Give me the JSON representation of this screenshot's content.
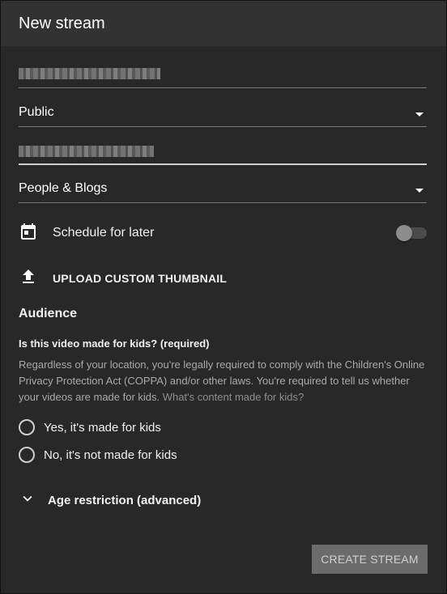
{
  "header": {
    "title": "New stream"
  },
  "visibility": {
    "value": "Public"
  },
  "category": {
    "value": "People & Blogs"
  },
  "schedule": {
    "label": "Schedule for later",
    "enabled": false
  },
  "thumbnail": {
    "label": "UPLOAD CUSTOM THUMBNAIL"
  },
  "audience": {
    "title": "Audience",
    "question": "Is this video made for kids? (required)",
    "description": "Regardless of your location, you're legally required to comply with the Children's Online Privacy Protection Act (COPPA) and/or other laws. You're required to tell us whether your videos are made for kids.",
    "link": "What's content made for kids?",
    "options": [
      "Yes, it's made for kids",
      "No, it's not made for kids"
    ]
  },
  "age_restriction": {
    "label": "Age restriction (advanced)"
  },
  "actions": {
    "create_label": "CREATE STREAM"
  },
  "icons": {
    "calendar": "calendar-icon",
    "upload": "upload-icon",
    "chevron": "chevron-down-icon"
  }
}
